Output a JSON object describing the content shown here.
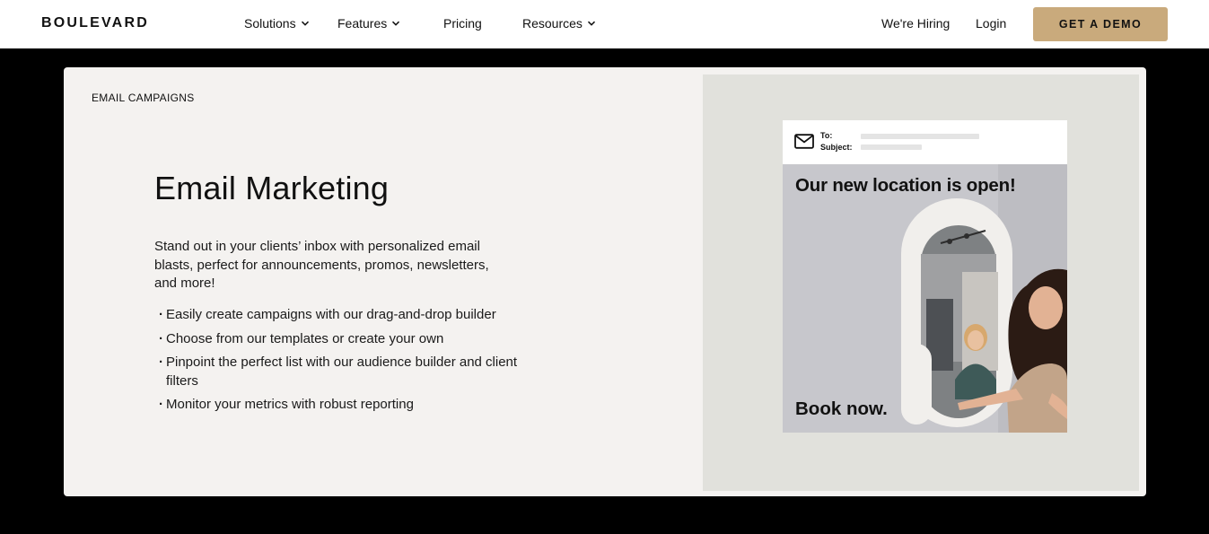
{
  "nav": {
    "logo": "BOULEVARD",
    "solutions": "Solutions",
    "features": "Features",
    "pricing": "Pricing",
    "resources": "Resources",
    "hiring": "We're Hiring",
    "login": "Login",
    "cta": "GET A DEMO"
  },
  "feature": {
    "eyebrow": "EMAIL CAMPAIGNS",
    "title": "Email Marketing",
    "description": "Stand out in your clients’ inbox with personalized email blasts, perfect for announcements, promos, newsletters, and more!",
    "bullets": [
      "Easily create campaigns with our drag-and-drop builder",
      "Choose from our templates or create your own",
      "Pinpoint the perfect list with our audience builder and client filters",
      "Monitor your metrics with robust reporting"
    ]
  },
  "email_preview": {
    "to_label": "To:",
    "subject_label": "Subject:",
    "headline": "Our new location is open!",
    "cta": "Book now."
  },
  "colors": {
    "page_bg": "#000000",
    "nav_bg": "#ffffff",
    "cta_bg": "#c9aa7c",
    "card_bg": "#f4f2f0",
    "visual_bg": "#e1e1dc"
  },
  "icons": {
    "chevron": "chevron-down-icon",
    "mail": "mail-icon"
  }
}
